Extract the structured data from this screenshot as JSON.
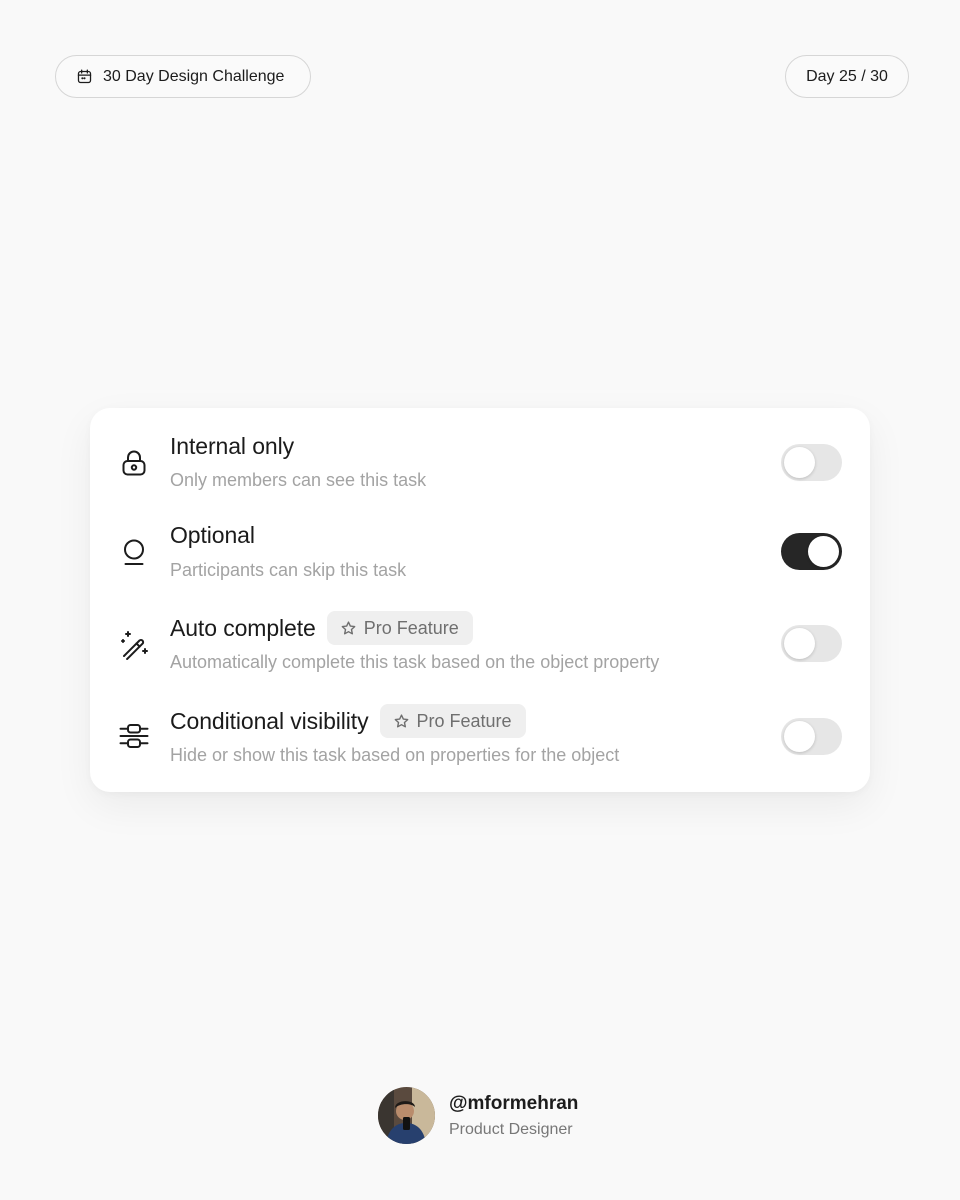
{
  "header": {
    "challenge_label": "30 Day Design Challenge",
    "challenge_icon": "calendar-icon",
    "day_label": "Day 25 / 30"
  },
  "settings": [
    {
      "id": "internal-only",
      "icon": "lock-icon",
      "title": "Internal only",
      "description": "Only members can see this task",
      "badge": null,
      "enabled": false
    },
    {
      "id": "optional",
      "icon": "user-icon",
      "title": "Optional",
      "description": "Participants can skip this task",
      "badge": null,
      "enabled": true
    },
    {
      "id": "auto-complete",
      "icon": "magic-wand-icon",
      "title": "Auto complete",
      "description": "Automatically complete this task based on the object property",
      "badge": "Pro Feature",
      "enabled": false
    },
    {
      "id": "conditional-visibility",
      "icon": "conditional-align-icon",
      "title": "Conditional visibility",
      "description": "Hide or show this task based on properties for the object",
      "badge": "Pro Feature",
      "enabled": false
    }
  ],
  "colors": {
    "background": "#f9f9f9",
    "card": "#ffffff",
    "toggle_on": "#262626",
    "toggle_off": "#e6e6e6",
    "badge_bg": "#efefef",
    "muted_text": "#a3a3a3"
  },
  "author": {
    "handle": "@mformehran",
    "role": "Product Designer"
  }
}
